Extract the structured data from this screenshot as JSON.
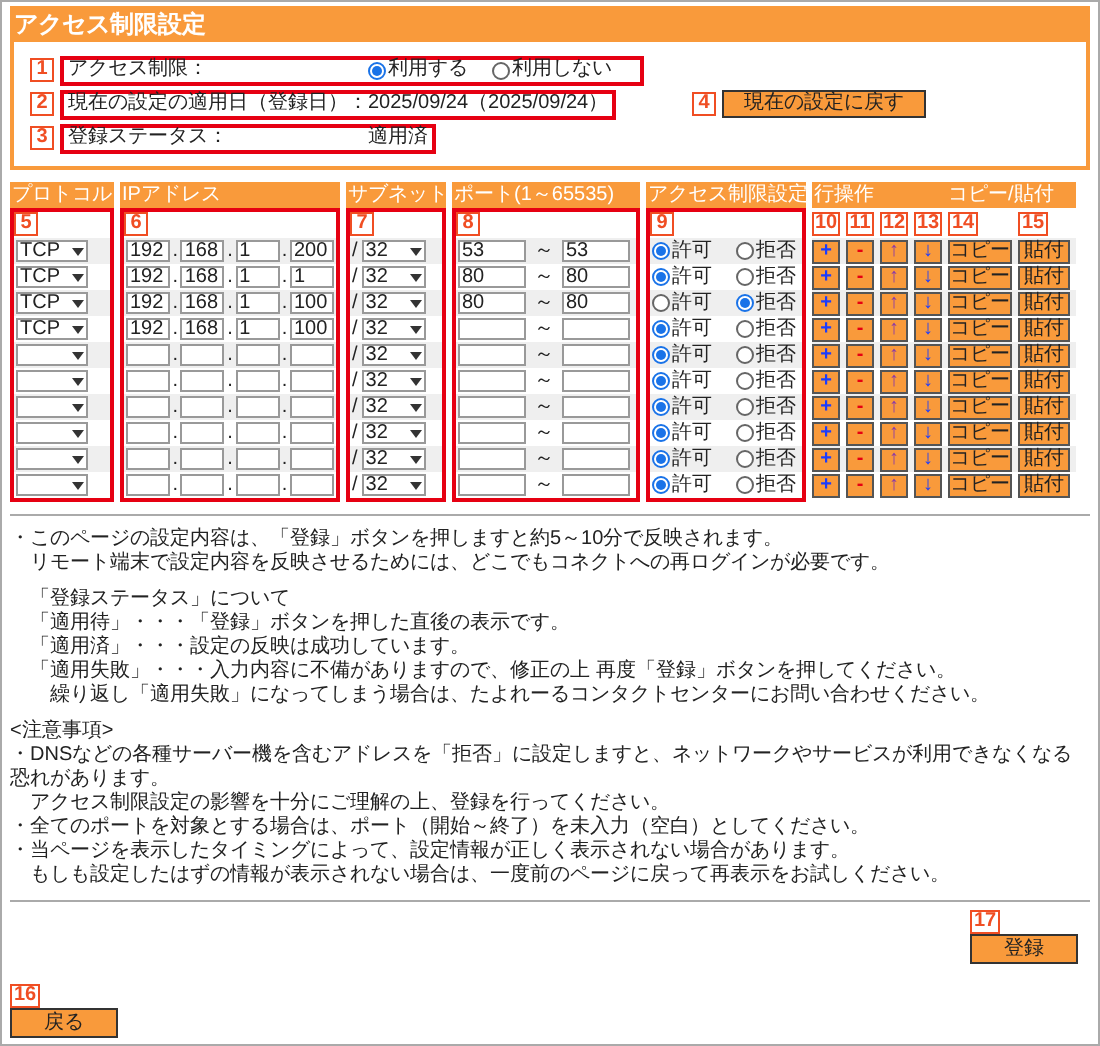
{
  "page_title": "アクセス制限設定",
  "settings": {
    "access_control": {
      "marker": "1",
      "label": "アクセス制限：",
      "options": [
        {
          "label": "利用する",
          "selected": true
        },
        {
          "label": "利用しない",
          "selected": false
        }
      ]
    },
    "applied_date": {
      "marker": "2",
      "label": "現在の設定の適用日（登録日）：",
      "value": "2025/09/24（2025/09/24）"
    },
    "status": {
      "marker": "3",
      "label": "登録ステータス：",
      "value": "適用済"
    },
    "reset_button": {
      "marker": "4",
      "label": "現在の設定に戻す"
    }
  },
  "table": {
    "columns": [
      {
        "header": "プロトコル",
        "markers": [
          "5"
        ]
      },
      {
        "header": "IPアドレス",
        "markers": [
          "6"
        ]
      },
      {
        "header": "サブネット",
        "markers": [
          "7"
        ]
      },
      {
        "header": "ポート(1～65535)",
        "markers": [
          "8"
        ]
      },
      {
        "header": "アクセス制限設定",
        "markers": [
          "9"
        ]
      },
      {
        "header": "行操作",
        "markers": [
          "10",
          "11",
          "12",
          "13"
        ]
      },
      {
        "header": "コピー/貼付",
        "markers": [
          "14",
          "15"
        ]
      }
    ],
    "rows": [
      {
        "protocol": "TCP",
        "ip": [
          "192",
          "168",
          "1",
          "200"
        ],
        "dots": [
          ".",
          ".",
          "."
        ],
        "slash": "/",
        "subnet": "32",
        "port_from": "53",
        "tilde": "～",
        "port_to": "53",
        "access": [
          {
            "label": "許可",
            "selected": true
          },
          {
            "label": "拒否",
            "selected": false
          }
        ],
        "actions": [
          "+",
          "-",
          "↑",
          "↓",
          "コピー",
          "貼付"
        ]
      },
      {
        "protocol": "TCP",
        "ip": [
          "192",
          "168",
          "1",
          "1"
        ],
        "dots": [
          ".",
          ".",
          "."
        ],
        "slash": "/",
        "subnet": "32",
        "port_from": "80",
        "tilde": "～",
        "port_to": "80",
        "access": [
          {
            "label": "許可",
            "selected": true
          },
          {
            "label": "拒否",
            "selected": false
          }
        ],
        "actions": [
          "+",
          "-",
          "↑",
          "↓",
          "コピー",
          "貼付"
        ]
      },
      {
        "protocol": "TCP",
        "ip": [
          "192",
          "168",
          "1",
          "100"
        ],
        "dots": [
          ".",
          ".",
          "."
        ],
        "slash": "/",
        "subnet": "32",
        "port_from": "80",
        "tilde": "～",
        "port_to": "80",
        "access": [
          {
            "label": "許可",
            "selected": false
          },
          {
            "label": "拒否",
            "selected": true
          }
        ],
        "actions": [
          "+",
          "-",
          "↑",
          "↓",
          "コピー",
          "貼付"
        ]
      },
      {
        "protocol": "TCP",
        "ip": [
          "192",
          "168",
          "1",
          "100"
        ],
        "dots": [
          ".",
          ".",
          "."
        ],
        "slash": "/",
        "subnet": "32",
        "tilde": "～",
        "access": [
          {
            "label": "許可",
            "selected": true
          },
          {
            "label": "拒否",
            "selected": false
          }
        ],
        "actions": [
          "+",
          "-",
          "↑",
          "↓",
          "コピー",
          "貼付"
        ]
      },
      {
        "dots": [
          ".",
          ".",
          "."
        ],
        "slash": "/",
        "subnet": "32",
        "tilde": "～",
        "access": [
          {
            "label": "許可",
            "selected": true
          },
          {
            "label": "拒否",
            "selected": false
          }
        ],
        "actions": [
          "+",
          "-",
          "↑",
          "↓",
          "コピー",
          "貼付"
        ]
      },
      {
        "dots": [
          ".",
          ".",
          "."
        ],
        "slash": "/",
        "subnet": "32",
        "tilde": "～",
        "access": [
          {
            "label": "許可",
            "selected": true
          },
          {
            "label": "拒否",
            "selected": false
          }
        ],
        "actions": [
          "+",
          "-",
          "↑",
          "↓",
          "コピー",
          "貼付"
        ]
      },
      {
        "dots": [
          ".",
          ".",
          "."
        ],
        "slash": "/",
        "subnet": "32",
        "tilde": "～",
        "access": [
          {
            "label": "許可",
            "selected": true
          },
          {
            "label": "拒否",
            "selected": false
          }
        ],
        "actions": [
          "+",
          "-",
          "↑",
          "↓",
          "コピー",
          "貼付"
        ]
      },
      {
        "dots": [
          ".",
          ".",
          "."
        ],
        "slash": "/",
        "subnet": "32",
        "tilde": "～",
        "access": [
          {
            "label": "許可",
            "selected": true
          },
          {
            "label": "拒否",
            "selected": false
          }
        ],
        "actions": [
          "+",
          "-",
          "↑",
          "↓",
          "コピー",
          "貼付"
        ]
      },
      {
        "dots": [
          ".",
          ".",
          "."
        ],
        "slash": "/",
        "subnet": "32",
        "tilde": "～",
        "access": [
          {
            "label": "許可",
            "selected": true
          },
          {
            "label": "拒否",
            "selected": false
          }
        ],
        "actions": [
          "+",
          "-",
          "↑",
          "↓",
          "コピー",
          "貼付"
        ]
      },
      {
        "dots": [
          ".",
          ".",
          "."
        ],
        "slash": "/",
        "subnet": "32",
        "tilde": "～",
        "access": [
          {
            "label": "許可",
            "selected": true
          },
          {
            "label": "拒否",
            "selected": false
          }
        ],
        "actions": [
          "+",
          "-",
          "↑",
          "↓",
          "コピー",
          "貼付"
        ]
      }
    ]
  },
  "notes": [
    {
      "items": [
        {
          "text": "・このページの設定内容は、「登録」ボタンを押しますと約5～10分で反映されます。",
          "continuation": [
            "リモート端末で設定内容を反映させるためには、どこでもコネクトへの再ログインが必要です。"
          ]
        }
      ]
    },
    {
      "heading": "「登録ステータス」について",
      "items": [
        {
          "text": "「適用待」・・・「登録」ボタンを押した直後の表示です。"
        },
        {
          "text": "「適用済」・・・設定の反映は成功しています。"
        },
        {
          "text": "「適用失敗」・・・入力内容に不備がありますので、修正の上 再度「登録」ボタンを押してください。",
          "continuation": [
            "繰り返し「適用失敗」になってしまう場合は、たよれーるコンタクトセンターにお問い合わせください。"
          ]
        }
      ]
    },
    {
      "heading": "<注意事項>",
      "items": [
        {
          "text": "・DNSなどの各種サーバー機を含むアドレスを「拒否」に設定しますと、ネットワークやサービスが利用できなくなる恐れがあります。",
          "continuation": [
            "アクセス制限設定の影響を十分にご理解の上、登録を行ってください。"
          ]
        },
        {
          "text": "・全てのポートを対象とする場合は、ポート（開始～終了）を未入力（空白）としてください。"
        },
        {
          "text": "・当ページを表示したタイミングによって、設定情報が正しく表示されない場合があります。",
          "continuation": [
            "もしも設定したはずの情報が表示されない場合は、一度前のページに戻って再表示をお試しください。"
          ]
        }
      ]
    }
  ],
  "register_button": {
    "marker": "17",
    "label": "登録"
  },
  "back_button": {
    "marker": "16",
    "label": "戻る"
  }
}
